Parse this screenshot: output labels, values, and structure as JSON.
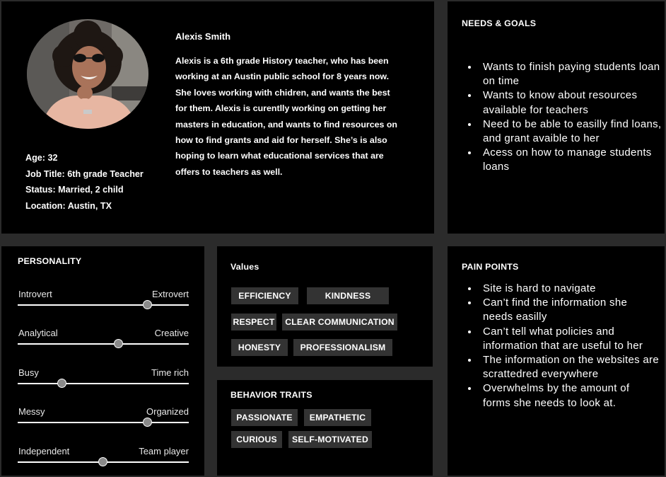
{
  "profile": {
    "name": "Alexis Smith",
    "bio": "Alexis is a 6th grade  History teacher, who has been working at an Austin public school for 8 years now. She loves working with chidren, and wants the best for them.  Alexis  is curentlly working on getting her masters in education, and  wants to find resources on how to find grants and aid for herself. She’s is also hoping to learn what educational services that are offers to teachers as well.",
    "bio_lines": [
      "Alexis is a 6th grade  History teacher, who has been",
      "working at an Austin public school for 8 years now.",
      "She loves working with chidren, and wants the best",
      "for them.  Alexis  is curentlly working on getting her",
      "masters in education, and  wants to find resources on",
      "how to find grants and aid for herself. She’s is also",
      "hoping to learn what educational services that are",
      "offers to teachers as well."
    ],
    "stats": [
      "Age: 32",
      "Job Title: 6th grade Teacher",
      "Status: Married, 2 child",
      "Location: Austin, TX"
    ]
  },
  "needs": {
    "title": "NEEDS & GOALS",
    "items": [
      "Wants to finish paying students loan on time",
      "Wants to know about resources available for teachers",
      "Need to be able to easilly find loans, and grant avaible to her",
      "Acess on how to manage students loans"
    ]
  },
  "personality": {
    "title": "PERSONALITY",
    "sliders": [
      {
        "left": "Introvert",
        "right": "Extrovert",
        "value": 0.76
      },
      {
        "left": "Analytical",
        "right": "Creative",
        "value": 0.59
      },
      {
        "left": "Busy",
        "right": "Time rich",
        "value": 0.26
      },
      {
        "left": "Messy",
        "right": "Organized",
        "value": 0.76
      },
      {
        "left": "Independent",
        "right": "Team player",
        "value": 0.5
      }
    ]
  },
  "values": {
    "title": "Values",
    "tags": [
      "EFFICIENCY",
      "KINDNESS",
      "RESPECT",
      "CLEAR COMMUNICATION",
      "HONESTY",
      "PROFESSIONALISM"
    ]
  },
  "behavior": {
    "title": "BEHAVIOR TRAITS",
    "tags": [
      "PASSIONATE",
      "EMPATHETIC",
      "CURIOUS",
      "SELF-MOTIVATED"
    ]
  },
  "pain": {
    "title": "PAIN POINTS",
    "items": [
      "Site is hard to navigate",
      "Can’t find the information she needs easilly",
      "Can’t tell what policies and information that are useful to her",
      "The information on the websites are scrattedred everywhere",
      "Overwhelms by the amount of forms she needs to look at."
    ]
  }
}
